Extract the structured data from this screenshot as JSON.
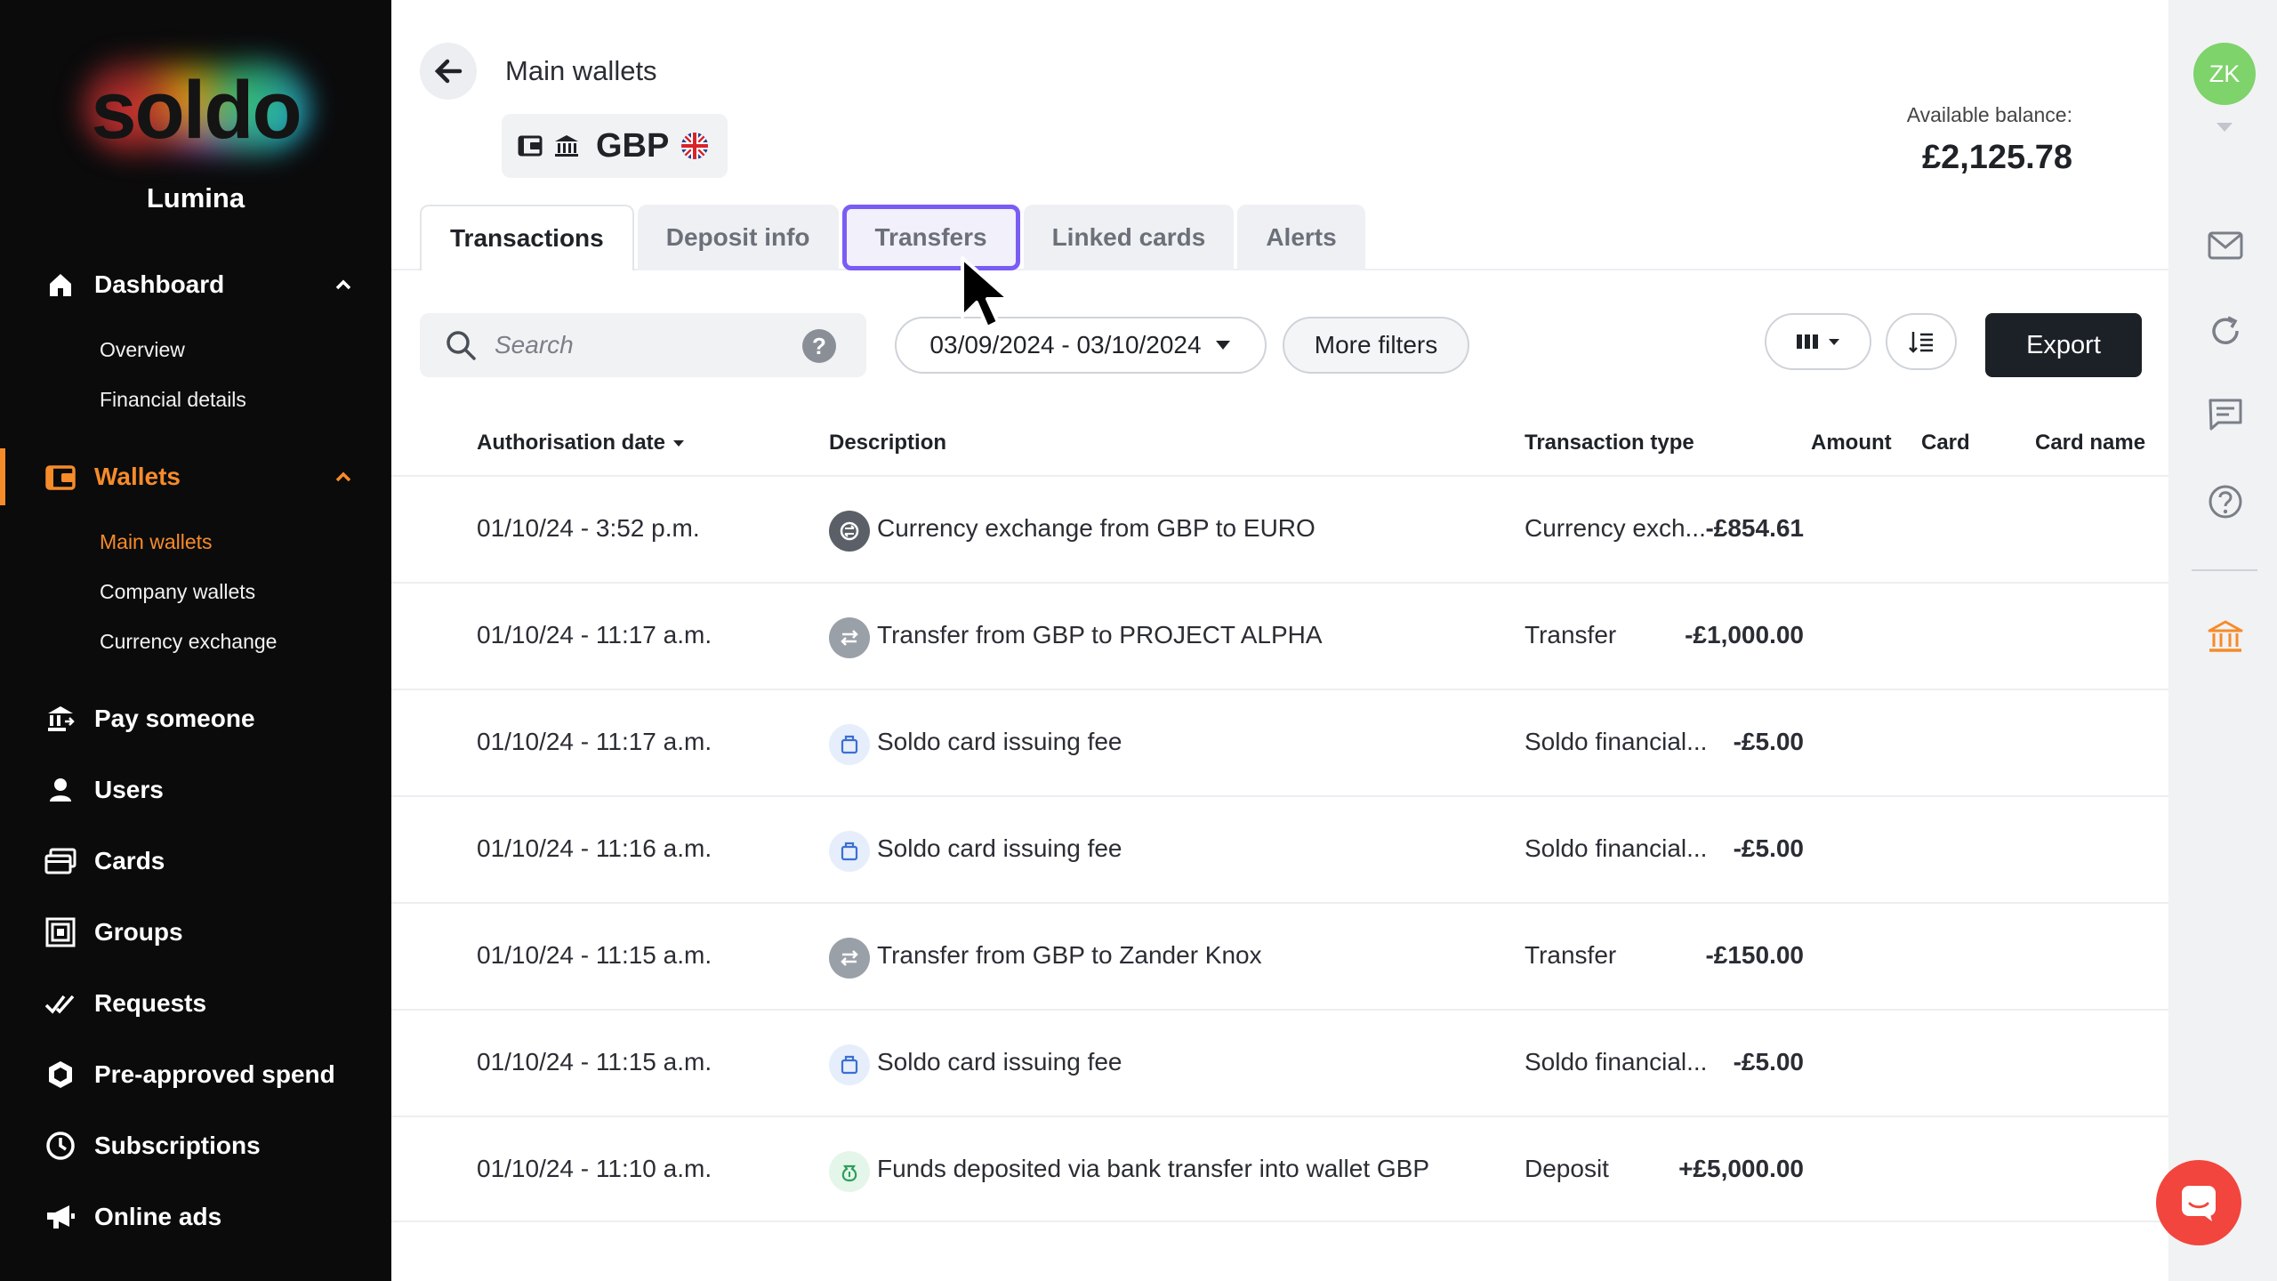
{
  "brand": {
    "logo_text": "soldo",
    "org_name": "Lumina",
    "accent": "#f68b2a"
  },
  "sidebar": {
    "items": [
      {
        "label": "Dashboard",
        "icon": "home-icon",
        "expanded": true,
        "children": [
          "Overview",
          "Financial details"
        ]
      },
      {
        "label": "Wallets",
        "icon": "wallet-icon",
        "expanded": true,
        "active": true,
        "children": [
          "Main wallets",
          "Company wallets",
          "Currency exchange"
        ]
      },
      {
        "label": "Pay someone",
        "icon": "bank-pay-icon"
      },
      {
        "label": "Users",
        "icon": "user-icon"
      },
      {
        "label": "Cards",
        "icon": "cards-icon"
      },
      {
        "label": "Groups",
        "icon": "groups-icon"
      },
      {
        "label": "Requests",
        "icon": "double-check-icon"
      },
      {
        "label": "Pre-approved spend",
        "icon": "shield-icon"
      },
      {
        "label": "Subscriptions",
        "icon": "clock-icon"
      },
      {
        "label": "Online ads",
        "icon": "megaphone-icon"
      }
    ]
  },
  "header": {
    "title": "Main wallets",
    "currency_code": "GBP",
    "balance_label": "Available balance:",
    "balance_value": "£2,125.78"
  },
  "tabs": [
    "Transactions",
    "Deposit info",
    "Transfers",
    "Linked cards",
    "Alerts"
  ],
  "toolbar": {
    "search_placeholder": "Search",
    "help": "?",
    "date_range": "03/09/2024 - 03/10/2024",
    "more_filters": "More filters",
    "export": "Export"
  },
  "table": {
    "headers": {
      "date": "Authorisation date",
      "description": "Description",
      "type": "Transaction type",
      "amount": "Amount",
      "card": "Card",
      "card_name": "Card name"
    },
    "rows": [
      {
        "date": "01/10/24 - 3:52 p.m.",
        "description": "Currency exchange from GBP to EURO",
        "type": "Currency exch...",
        "amount": "-£854.61",
        "icon": "exchange-icon"
      },
      {
        "date": "01/10/24 - 11:17 a.m.",
        "description": "Transfer from GBP to PROJECT ALPHA",
        "type": "Transfer",
        "amount": "-£1,000.00",
        "icon": "transfer-icon"
      },
      {
        "date": "01/10/24 - 11:17 a.m.",
        "description": "Soldo card issuing fee",
        "type": "Soldo financial...",
        "amount": "-£5.00",
        "icon": "fee-icon"
      },
      {
        "date": "01/10/24 - 11:16 a.m.",
        "description": "Soldo card issuing fee",
        "type": "Soldo financial...",
        "amount": "-£5.00",
        "icon": "fee-icon"
      },
      {
        "date": "01/10/24 - 11:15 a.m.",
        "description": "Transfer from GBP to Zander Knox",
        "type": "Transfer",
        "amount": "-£150.00",
        "icon": "transfer-icon"
      },
      {
        "date": "01/10/24 - 11:15 a.m.",
        "description": "Soldo card issuing fee",
        "type": "Soldo financial...",
        "amount": "-£5.00",
        "icon": "fee-icon"
      },
      {
        "date": "01/10/24 - 11:10 a.m.",
        "description": "Funds deposited via bank transfer into wallet GBP",
        "type": "Deposit",
        "amount": "+£5,000.00",
        "icon": "deposit-icon"
      }
    ]
  },
  "rail": {
    "avatar_initials": "ZK",
    "avatar_color": "#7ed36b"
  }
}
